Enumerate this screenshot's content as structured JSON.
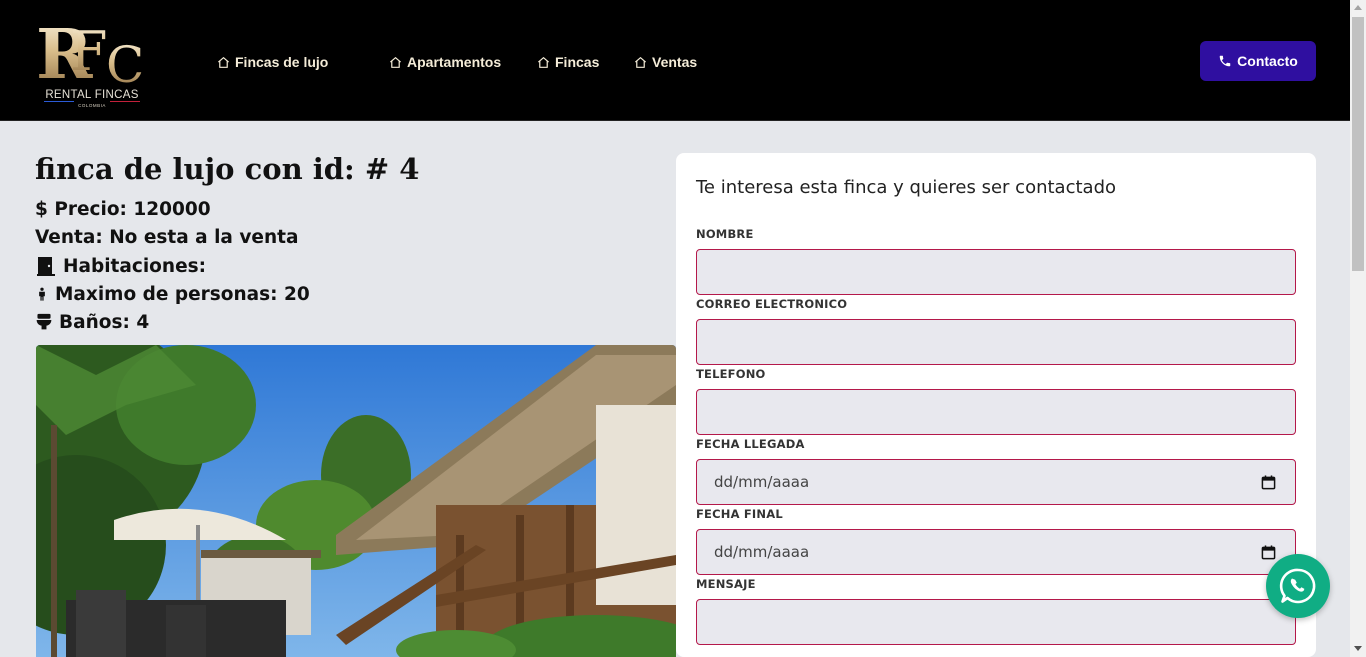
{
  "brand": {
    "logo_text": "RFC",
    "name": "RENTAL FINCAS",
    "country": "COLOMBIA"
  },
  "nav": {
    "items": [
      {
        "label": "Fincas de lujo",
        "icon": "home-icon"
      },
      {
        "label": "Apartamentos",
        "icon": "home-icon"
      },
      {
        "label": "Fincas",
        "icon": "home-icon"
      },
      {
        "label": "Ventas",
        "icon": "home-icon"
      }
    ],
    "contact_label": "Contacto",
    "contact_icon": "phone-icon"
  },
  "property": {
    "title": "finca de lujo con id: # 4",
    "price": "$ Precio: 120000",
    "sale": "Venta: No esta a la venta",
    "rooms": "Habitaciones:",
    "max_people": "Maximo de personas: 20",
    "baths": "Baños: 4"
  },
  "form": {
    "title": "Te interesa esta finca y quieres ser contactado",
    "fields": [
      {
        "label": "NOMBRE",
        "value": "",
        "type": "text"
      },
      {
        "label": "CORREO ELECTRONICO",
        "value": "",
        "type": "email"
      },
      {
        "label": "TELEFONO",
        "value": "",
        "type": "tel"
      },
      {
        "label": "FECHA LLEGADA",
        "placeholder": "dd/mm/aaaa",
        "type": "date"
      },
      {
        "label": "FECHA FINAL",
        "placeholder": "dd/mm/aaaa",
        "type": "date"
      },
      {
        "label": "MENSAJE",
        "value": "",
        "type": "textarea"
      }
    ]
  },
  "colors": {
    "navbar_bg": "#000000",
    "nav_text": "#f4ecd8",
    "contact_button": "#2f0fa0",
    "page_bg": "#e5e7eb",
    "input_border": "#b4184a",
    "whatsapp": "#10ad84"
  },
  "floating": {
    "icon": "whatsapp-icon"
  }
}
